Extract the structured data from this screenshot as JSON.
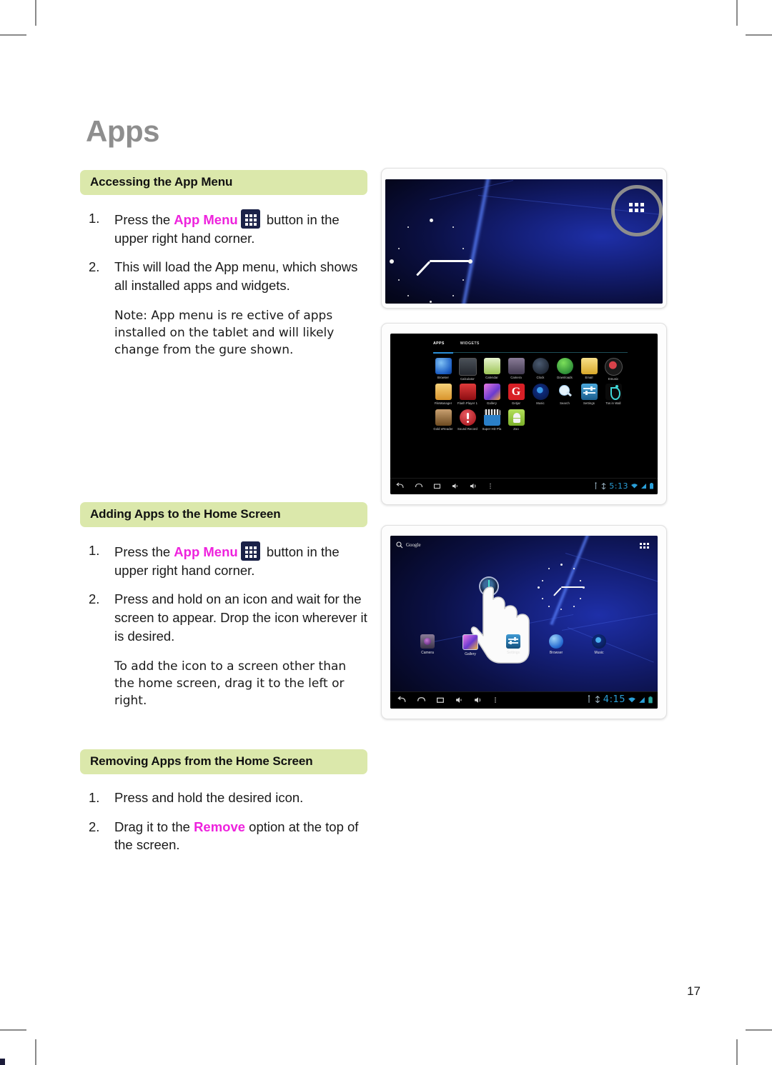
{
  "page": {
    "title": "Apps",
    "number": "17"
  },
  "sections": [
    {
      "header": "Accessing the App Menu",
      "steps": [
        {
          "num": "1.",
          "pre": "Press the ",
          "highlight": "App Menu",
          "icon": "app-menu-grid-icon",
          "post": " button in the upper right hand corner."
        },
        {
          "num": "2.",
          "text": "This will load the App menu, which shows all installed apps and widgets."
        }
      ],
      "note": "Note: App menu is re ective of apps installed on the tablet and will likely change from the  gure shown."
    },
    {
      "header": "Adding Apps to the Home Screen",
      "steps": [
        {
          "num": "1.",
          "pre": "Press the ",
          "highlight": "App Menu",
          "icon": "app-menu-grid-icon",
          "post": " button in the upper right hand corner."
        },
        {
          "num": "2.",
          "text": "Press and hold on an icon and wait for the screen to appear. Drop the icon wherever it is desired."
        }
      ],
      "note": "To add the icon to a screen other than the home screen, drag it to the left or right."
    },
    {
      "header": "Removing Apps from the Home Screen",
      "steps": [
        {
          "num": "1.",
          "text": "Press and hold the desired icon."
        },
        {
          "num": "2.",
          "pre": "Drag it to the ",
          "highlight": "Remove",
          "post": " option at the top of the screen."
        }
      ]
    }
  ],
  "figures": {
    "home_highlight": {
      "caption_icon": "app-menu-grid-icon",
      "highlight_shape": "circle"
    },
    "app_drawer": {
      "tabs": [
        {
          "label": "APPS",
          "active": true
        },
        {
          "label": "WIDGETS",
          "active": false
        }
      ],
      "apps": [
        {
          "label": "Browser",
          "icon": "browser-globe-icon",
          "color": "#2a6fd4"
        },
        {
          "label": "Calculator",
          "icon": "calculator-icon",
          "color": "#3a3f46"
        },
        {
          "label": "Calendar",
          "icon": "calendar-icon",
          "color": "#8ec63f"
        },
        {
          "label": "Camera",
          "icon": "camera-icon",
          "color": "#6b5e7a"
        },
        {
          "label": "Clock",
          "icon": "clock-icon",
          "color": "#1a2230"
        },
        {
          "label": "Downloads",
          "icon": "downloads-icon",
          "color": "#1f7a3a"
        },
        {
          "label": "Email",
          "icon": "email-envelope-icon",
          "color": "#e8c23a"
        },
        {
          "label": "Emusic",
          "icon": "emusic-icon",
          "color": "#1a1a1a"
        },
        {
          "label": "FileManager",
          "icon": "file-folder-icon",
          "color": "#e2a83c"
        },
        {
          "label": "Flash Player 1",
          "icon": "flash-player-icon",
          "color": "#c2171e"
        },
        {
          "label": "Gallery",
          "icon": "gallery-icon",
          "color": "#9b3fc4"
        },
        {
          "label": "Getjar",
          "icon": "getjar-icon",
          "color": "#d81f26"
        },
        {
          "label": "Music",
          "icon": "music-icon",
          "color": "#1a3c8c"
        },
        {
          "label": "Search",
          "icon": "search-magnifier-icon",
          "color": "#1a1a1a"
        },
        {
          "label": "Settings",
          "icon": "settings-sliders-icon",
          "color": "#2a7fb8"
        },
        {
          "label": "Tos in Wall",
          "icon": "tos-in-wall-icon",
          "color": "#1a1a1a"
        },
        {
          "label": "Gold eReader",
          "icon": "ereader-book-icon",
          "color": "#8a6030"
        },
        {
          "label": "Sound Record",
          "icon": "sound-record-icon",
          "color": "#c21a22"
        },
        {
          "label": "Super HD Pla",
          "icon": "super-hd-player-icon",
          "color": "#2a6fb8"
        },
        {
          "label": "Zoo",
          "icon": "android-zoo-icon",
          "color": "#8ec63f"
        }
      ],
      "statusbar": {
        "time": "5:13",
        "icons": [
          "back-icon",
          "home-icon",
          "recents-icon",
          "volume-down-icon",
          "volume-up-icon",
          "menu-dots-icon"
        ],
        "right_icons": [
          "usb-icon",
          "sync-icon",
          "wifi-icon",
          "signal-icon",
          "battery-icon"
        ]
      }
    },
    "home_drag": {
      "search_label": "Google",
      "search_icon": "search-magnifier-icon",
      "grid_icon": "app-menu-grid-icon",
      "cursor": "hand-drag-cursor",
      "dock": [
        {
          "label": "Camera",
          "icon": "camera-icon"
        },
        {
          "label": "Gallery",
          "icon": "gallery-icon"
        },
        {
          "label": "Settings",
          "icon": "settings-sliders-icon"
        },
        {
          "label": "Browser",
          "icon": "browser-globe-icon"
        },
        {
          "label": "Music",
          "icon": "music-icon"
        }
      ],
      "statusbar": {
        "time": "4:15",
        "icons": [
          "back-icon",
          "home-icon",
          "recents-icon",
          "volume-down-icon",
          "volume-up-icon",
          "menu-dots-icon"
        ],
        "right_icons": [
          "usb-icon",
          "sync-icon",
          "wifi-icon",
          "signal-icon",
          "battery-icon"
        ]
      }
    }
  },
  "colors": {
    "section_header_bg": "#dbe8ab",
    "highlight_text": "#ee22dd",
    "title_gray": "#8e8e8e",
    "app_menu_button_bg": "#1b2248"
  }
}
